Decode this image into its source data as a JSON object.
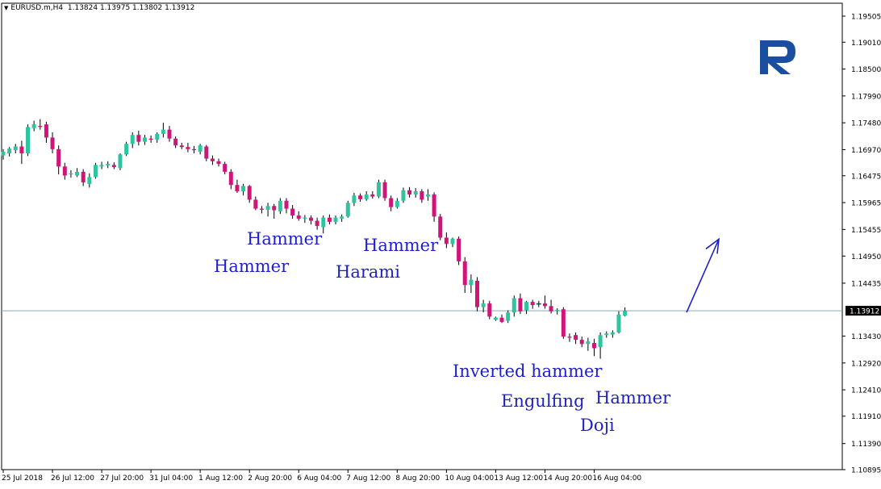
{
  "header": {
    "symbol": "EURUSD.m,H4",
    "ohlc": "1.13824 1.13975 1.13802 1.13912"
  },
  "colors": {
    "bull": "#2ec4a0",
    "bear": "#d0157a",
    "wick": "#000000",
    "annotation": "#1f1fc8",
    "price_line": "#8aa6b5",
    "axis": "#000000",
    "logo": "#1a4fa0"
  },
  "patterns": [
    {
      "id": "hammer-1",
      "text": "Hammer"
    },
    {
      "id": "hammer-2",
      "text": "Hammer"
    },
    {
      "id": "harami",
      "text": "Harami"
    },
    {
      "id": "hammer-3",
      "text": "Hammer"
    },
    {
      "id": "inverted-hammer",
      "text": "Inverted hammer"
    },
    {
      "id": "engulfing",
      "text": "Engulfing"
    },
    {
      "id": "hammer-4",
      "text": "Hammer"
    },
    {
      "id": "doji",
      "text": "Doji"
    }
  ],
  "chart_data": {
    "type": "candlestick",
    "title": "EURUSD.m,H4",
    "current_price": "1.13912",
    "y_ticks": [
      "1.19505",
      "1.19010",
      "1.18500",
      "1.17990",
      "1.17480",
      "1.16970",
      "1.16475",
      "1.15965",
      "1.15455",
      "1.14950",
      "1.14435",
      "1.13430",
      "1.12920",
      "1.12410",
      "1.11910",
      "1.11390",
      "1.10895"
    ],
    "x_ticks": [
      "25 Jul 2018",
      "26 Jul 12:00",
      "27 Jul 20:00",
      "31 Jul 04:00",
      "1 Aug 12:00",
      "2 Aug 20:00",
      "6 Aug 04:00",
      "7 Aug 12:00",
      "8 Aug 20:00",
      "10 Aug 04:00",
      "13 Aug 12:00",
      "14 Aug 20:00",
      "16 Aug 04:00"
    ],
    "ylim": [
      1.10895,
      1.1975
    ],
    "candles": [
      {
        "o": 1.1686,
        "h": 1.1698,
        "l": 1.1678,
        "c": 1.1693
      },
      {
        "o": 1.169,
        "h": 1.1702,
        "l": 1.1684,
        "c": 1.1699
      },
      {
        "o": 1.1696,
        "h": 1.1708,
        "l": 1.169,
        "c": 1.1703
      },
      {
        "o": 1.1703,
        "h": 1.1714,
        "l": 1.167,
        "c": 1.169
      },
      {
        "o": 1.169,
        "h": 1.1745,
        "l": 1.1685,
        "c": 1.174
      },
      {
        "o": 1.1738,
        "h": 1.1752,
        "l": 1.1732,
        "c": 1.1745
      },
      {
        "o": 1.1742,
        "h": 1.1755,
        "l": 1.1735,
        "c": 1.174
      },
      {
        "o": 1.1745,
        "h": 1.175,
        "l": 1.171,
        "c": 1.172
      },
      {
        "o": 1.172,
        "h": 1.173,
        "l": 1.169,
        "c": 1.1698
      },
      {
        "o": 1.1698,
        "h": 1.1705,
        "l": 1.165,
        "c": 1.1665
      },
      {
        "o": 1.1665,
        "h": 1.1672,
        "l": 1.164,
        "c": 1.1648
      },
      {
        "o": 1.165,
        "h": 1.1658,
        "l": 1.1644,
        "c": 1.1652
      },
      {
        "o": 1.1648,
        "h": 1.1662,
        "l": 1.1645,
        "c": 1.1655
      },
      {
        "o": 1.1655,
        "h": 1.166,
        "l": 1.1628,
        "c": 1.1635
      },
      {
        "o": 1.1632,
        "h": 1.1652,
        "l": 1.1625,
        "c": 1.1645
      },
      {
        "o": 1.1645,
        "h": 1.1672,
        "l": 1.1642,
        "c": 1.1668
      },
      {
        "o": 1.1665,
        "h": 1.1674,
        "l": 1.166,
        "c": 1.1668
      },
      {
        "o": 1.1667,
        "h": 1.1675,
        "l": 1.1662,
        "c": 1.167
      },
      {
        "o": 1.1668,
        "h": 1.1673,
        "l": 1.166,
        "c": 1.1664
      },
      {
        "o": 1.1662,
        "h": 1.169,
        "l": 1.1658,
        "c": 1.1688
      },
      {
        "o": 1.1688,
        "h": 1.1712,
        "l": 1.1685,
        "c": 1.1708
      },
      {
        "o": 1.1708,
        "h": 1.173,
        "l": 1.17,
        "c": 1.1725
      },
      {
        "o": 1.1725,
        "h": 1.1733,
        "l": 1.1705,
        "c": 1.1712
      },
      {
        "o": 1.1712,
        "h": 1.1725,
        "l": 1.1706,
        "c": 1.172
      },
      {
        "o": 1.1718,
        "h": 1.1724,
        "l": 1.171,
        "c": 1.1716
      },
      {
        "o": 1.1716,
        "h": 1.173,
        "l": 1.171,
        "c": 1.1727
      },
      {
        "o": 1.1727,
        "h": 1.1748,
        "l": 1.172,
        "c": 1.1735
      },
      {
        "o": 1.1735,
        "h": 1.1742,
        "l": 1.1712,
        "c": 1.1718
      },
      {
        "o": 1.1718,
        "h": 1.1722,
        "l": 1.17,
        "c": 1.1705
      },
      {
        "o": 1.1705,
        "h": 1.171,
        "l": 1.1698,
        "c": 1.1702
      },
      {
        "o": 1.1702,
        "h": 1.171,
        "l": 1.1692,
        "c": 1.1698
      },
      {
        "o": 1.1698,
        "h": 1.1704,
        "l": 1.169,
        "c": 1.1696
      },
      {
        "o": 1.1693,
        "h": 1.1708,
        "l": 1.1688,
        "c": 1.1705
      },
      {
        "o": 1.1703,
        "h": 1.1706,
        "l": 1.1675,
        "c": 1.168
      },
      {
        "o": 1.168,
        "h": 1.1686,
        "l": 1.1668,
        "c": 1.1675
      },
      {
        "o": 1.1675,
        "h": 1.168,
        "l": 1.1665,
        "c": 1.167
      },
      {
        "o": 1.167,
        "h": 1.1674,
        "l": 1.165,
        "c": 1.1655
      },
      {
        "o": 1.1655,
        "h": 1.166,
        "l": 1.1622,
        "c": 1.163
      },
      {
        "o": 1.163,
        "h": 1.164,
        "l": 1.1615,
        "c": 1.1618
      },
      {
        "o": 1.1618,
        "h": 1.1632,
        "l": 1.161,
        "c": 1.1628
      },
      {
        "o": 1.1628,
        "h": 1.163,
        "l": 1.1596,
        "c": 1.1602
      },
      {
        "o": 1.1602,
        "h": 1.1608,
        "l": 1.1582,
        "c": 1.1585
      },
      {
        "o": 1.1585,
        "h": 1.159,
        "l": 1.1576,
        "c": 1.1583
      },
      {
        "o": 1.1583,
        "h": 1.1596,
        "l": 1.157,
        "c": 1.159
      },
      {
        "o": 1.159,
        "h": 1.1594,
        "l": 1.1566,
        "c": 1.1582
      },
      {
        "o": 1.158,
        "h": 1.1605,
        "l": 1.1575,
        "c": 1.16
      },
      {
        "o": 1.16,
        "h": 1.1605,
        "l": 1.1576,
        "c": 1.1585
      },
      {
        "o": 1.1585,
        "h": 1.1592,
        "l": 1.1566,
        "c": 1.1572
      },
      {
        "o": 1.1572,
        "h": 1.158,
        "l": 1.1562,
        "c": 1.1566
      },
      {
        "o": 1.1566,
        "h": 1.1573,
        "l": 1.1558,
        "c": 1.1568
      },
      {
        "o": 1.1568,
        "h": 1.1572,
        "l": 1.1555,
        "c": 1.1562
      },
      {
        "o": 1.1562,
        "h": 1.1568,
        "l": 1.1545,
        "c": 1.1552
      },
      {
        "o": 1.155,
        "h": 1.1572,
        "l": 1.1538,
        "c": 1.1568
      },
      {
        "o": 1.1568,
        "h": 1.1574,
        "l": 1.1555,
        "c": 1.156
      },
      {
        "o": 1.156,
        "h": 1.1572,
        "l": 1.1555,
        "c": 1.1568
      },
      {
        "o": 1.1566,
        "h": 1.1574,
        "l": 1.156,
        "c": 1.157
      },
      {
        "o": 1.157,
        "h": 1.16,
        "l": 1.1568,
        "c": 1.1596
      },
      {
        "o": 1.1596,
        "h": 1.1615,
        "l": 1.159,
        "c": 1.161
      },
      {
        "o": 1.161,
        "h": 1.1614,
        "l": 1.1598,
        "c": 1.1603
      },
      {
        "o": 1.1603,
        "h": 1.1618,
        "l": 1.16,
        "c": 1.1612
      },
      {
        "o": 1.1612,
        "h": 1.1618,
        "l": 1.1604,
        "c": 1.1608
      },
      {
        "o": 1.1608,
        "h": 1.164,
        "l": 1.1605,
        "c": 1.1635
      },
      {
        "o": 1.1635,
        "h": 1.164,
        "l": 1.16,
        "c": 1.1605
      },
      {
        "o": 1.1605,
        "h": 1.161,
        "l": 1.158,
        "c": 1.1588
      },
      {
        "o": 1.1588,
        "h": 1.1605,
        "l": 1.1585,
        "c": 1.16
      },
      {
        "o": 1.16,
        "h": 1.1625,
        "l": 1.1596,
        "c": 1.162
      },
      {
        "o": 1.162,
        "h": 1.1626,
        "l": 1.1606,
        "c": 1.1612
      },
      {
        "o": 1.1612,
        "h": 1.1624,
        "l": 1.1606,
        "c": 1.1618
      },
      {
        "o": 1.1618,
        "h": 1.1622,
        "l": 1.1596,
        "c": 1.1602
      },
      {
        "o": 1.1608,
        "h": 1.1622,
        "l": 1.16,
        "c": 1.1612
      },
      {
        "o": 1.1612,
        "h": 1.1616,
        "l": 1.156,
        "c": 1.157
      },
      {
        "o": 1.157,
        "h": 1.1575,
        "l": 1.1525,
        "c": 1.153
      },
      {
        "o": 1.153,
        "h": 1.154,
        "l": 1.151,
        "c": 1.1518
      },
      {
        "o": 1.1518,
        "h": 1.153,
        "l": 1.1512,
        "c": 1.1528
      },
      {
        "o": 1.1528,
        "h": 1.1532,
        "l": 1.1478,
        "c": 1.1485
      },
      {
        "o": 1.1485,
        "h": 1.1493,
        "l": 1.1425,
        "c": 1.144
      },
      {
        "o": 1.144,
        "h": 1.146,
        "l": 1.1425,
        "c": 1.145
      },
      {
        "o": 1.1448,
        "h": 1.1455,
        "l": 1.139,
        "c": 1.1398
      },
      {
        "o": 1.1398,
        "h": 1.1412,
        "l": 1.1388,
        "c": 1.1405
      },
      {
        "o": 1.1405,
        "h": 1.141,
        "l": 1.1375,
        "c": 1.138
      },
      {
        "o": 1.1374,
        "h": 1.138,
        "l": 1.1372,
        "c": 1.1378
      },
      {
        "o": 1.1378,
        "h": 1.1384,
        "l": 1.1368,
        "c": 1.137
      },
      {
        "o": 1.1372,
        "h": 1.1392,
        "l": 1.1368,
        "c": 1.1388
      },
      {
        "o": 1.1388,
        "h": 1.142,
        "l": 1.138,
        "c": 1.1415
      },
      {
        "o": 1.1415,
        "h": 1.1424,
        "l": 1.1385,
        "c": 1.139
      },
      {
        "o": 1.1392,
        "h": 1.141,
        "l": 1.1385,
        "c": 1.1408
      },
      {
        "o": 1.1408,
        "h": 1.1412,
        "l": 1.1395,
        "c": 1.1402
      },
      {
        "o": 1.1404,
        "h": 1.141,
        "l": 1.1398,
        "c": 1.1405
      },
      {
        "o": 1.1405,
        "h": 1.142,
        "l": 1.1395,
        "c": 1.14
      },
      {
        "o": 1.14,
        "h": 1.1412,
        "l": 1.1386,
        "c": 1.139
      },
      {
        "o": 1.1391,
        "h": 1.1396,
        "l": 1.1384,
        "c": 1.1393
      },
      {
        "o": 1.1394,
        "h": 1.1398,
        "l": 1.1338,
        "c": 1.1342
      },
      {
        "o": 1.1342,
        "h": 1.1348,
        "l": 1.1332,
        "c": 1.134
      },
      {
        "o": 1.1345,
        "h": 1.135,
        "l": 1.1328,
        "c": 1.1336
      },
      {
        "o": 1.1336,
        "h": 1.1342,
        "l": 1.1322,
        "c": 1.1328
      },
      {
        "o": 1.1328,
        "h": 1.134,
        "l": 1.1315,
        "c": 1.1333
      },
      {
        "o": 1.133,
        "h": 1.1338,
        "l": 1.1305,
        "c": 1.132
      },
      {
        "o": 1.1322,
        "h": 1.135,
        "l": 1.13,
        "c": 1.1345
      },
      {
        "o": 1.1345,
        "h": 1.1352,
        "l": 1.134,
        "c": 1.1348
      },
      {
        "o": 1.1346,
        "h": 1.1354,
        "l": 1.134,
        "c": 1.135
      },
      {
        "o": 1.135,
        "h": 1.139,
        "l": 1.1348,
        "c": 1.1384
      },
      {
        "o": 1.1382,
        "h": 1.13975,
        "l": 1.13802,
        "c": 1.13912
      }
    ]
  }
}
